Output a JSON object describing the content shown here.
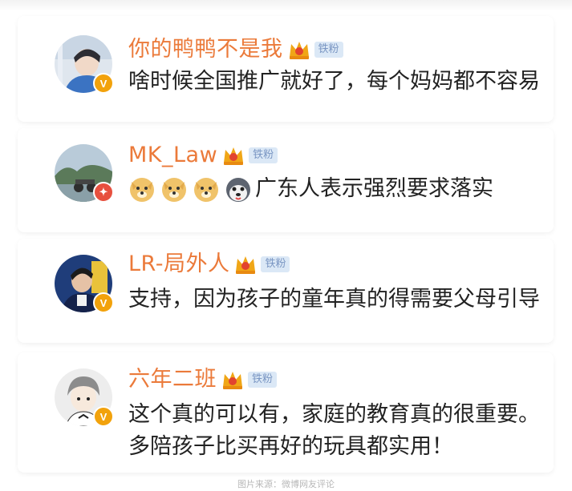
{
  "comments": [
    {
      "username": "你的鸭鸭不是我",
      "tag": "铁粉",
      "badge_color": "#f2a20c",
      "badge_letter": "V",
      "lines": [
        "啥时候全国推广就好了，每个妈妈都不容易"
      ]
    },
    {
      "username": "MK_Law",
      "tag": "铁粉",
      "badge_color": "#e7503f",
      "badge_letter": "✦",
      "emojis": [
        "doge-emoji",
        "doge-emoji",
        "doge-emoji",
        "husky-emoji"
      ],
      "lines": [
        "广东人表示强烈要求落实"
      ]
    },
    {
      "username": "LR-局外人",
      "tag": "铁粉",
      "badge_color": "#f2a20c",
      "badge_letter": "V",
      "lines": [
        "支持，因为孩子的童年真的得需要父母引导"
      ]
    },
    {
      "username": "六年二班",
      "tag": "铁粉",
      "badge_color": "#f2a20c",
      "badge_letter": "V",
      "lines": [
        "这个真的可以有，家庭的教育真的很重要。",
        "多陪孩子比买再好的玩具都实用！"
      ]
    }
  ],
  "footer": "图片来源：微博网友评论",
  "colors": {
    "username": "#eb7a3a",
    "text": "#222222",
    "tag_bg": "#dbe8f6",
    "tag_text": "#7a96c3"
  }
}
